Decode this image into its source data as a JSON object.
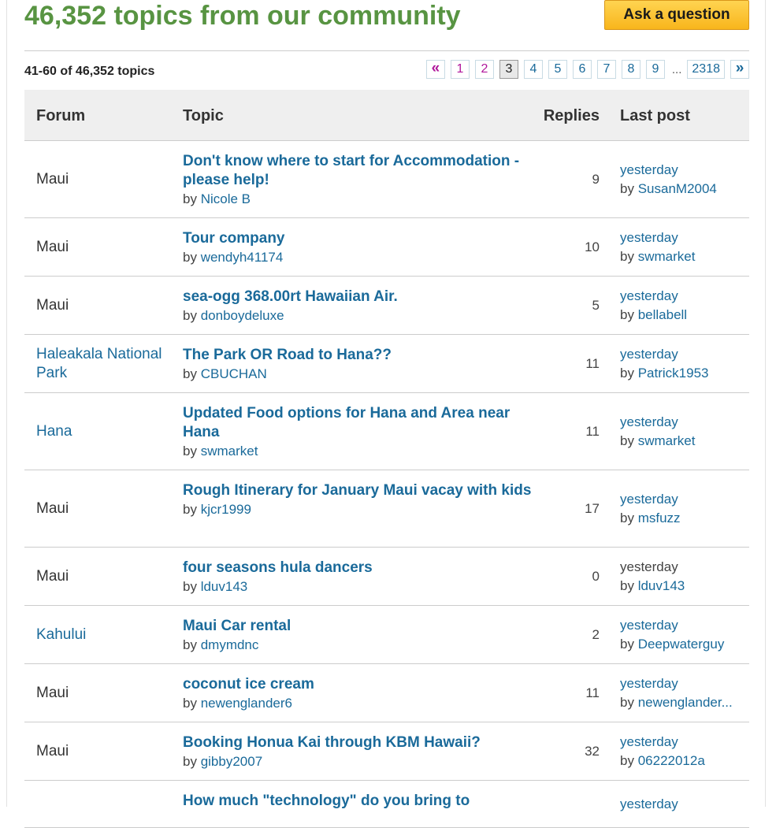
{
  "header": {
    "title": "46,352 topics from our community",
    "ask_button": "Ask a question"
  },
  "pager": {
    "count_text": "41-60 of 46,352 topics",
    "prev": "«",
    "next": "»",
    "pages": [
      "1",
      "2",
      "3",
      "4",
      "5",
      "6",
      "7",
      "8",
      "9"
    ],
    "current_page": "3",
    "ellipsis": "...",
    "last_page": "2318"
  },
  "columns": {
    "forum": "Forum",
    "topic": "Topic",
    "replies": "Replies",
    "last_post": "Last post"
  },
  "by_label": "by",
  "rows": [
    {
      "forum": "Maui",
      "forum_link": false,
      "title": "Don't know where to start for Accommodation - please help!",
      "author": "Nicole B",
      "replies": "9",
      "when": "yesterday",
      "when_link": true,
      "last_by": "SusanM2004"
    },
    {
      "forum": "Maui",
      "forum_link": false,
      "title": "Tour company",
      "author": "wendyh41174",
      "replies": "10",
      "when": "yesterday",
      "when_link": true,
      "last_by": "swmarket"
    },
    {
      "forum": "Maui",
      "forum_link": false,
      "title": "sea-ogg 368.00rt Hawaiian Air.",
      "author": "donboydeluxe",
      "replies": "5",
      "when": "yesterday",
      "when_link": true,
      "last_by": "bellabell"
    },
    {
      "forum": "Haleakala National Park",
      "forum_link": true,
      "title": "The Park OR Road to Hana??",
      "author": "CBUCHAN",
      "replies": "11",
      "when": "yesterday",
      "when_link": true,
      "last_by": "Patrick1953"
    },
    {
      "forum": "Hana",
      "forum_link": true,
      "title": "Updated Food options for Hana and Area near Hana",
      "author": "swmarket",
      "replies": "11",
      "when": "yesterday",
      "when_link": true,
      "last_by": "swmarket"
    },
    {
      "forum": "Maui",
      "forum_link": false,
      "title": "Rough Itinerary for January Maui vacay with kids",
      "author": "kjcr1999",
      "replies": "17",
      "when": "yesterday",
      "when_link": true,
      "last_by": "msfuzz"
    },
    {
      "forum": "Maui",
      "forum_link": false,
      "title": "four seasons hula dancers",
      "author": "lduv143",
      "replies": "0",
      "when": "yesterday",
      "when_link": false,
      "last_by": "lduv143"
    },
    {
      "forum": "Kahului",
      "forum_link": true,
      "title": "Maui Car rental",
      "author": "dmymdnc",
      "replies": "2",
      "when": "yesterday",
      "when_link": true,
      "last_by": "Deepwaterguy"
    },
    {
      "forum": "Maui",
      "forum_link": false,
      "title": "coconut ice cream",
      "author": "newenglander6",
      "replies": "11",
      "when": "yesterday",
      "when_link": true,
      "last_by": "newenglander..."
    },
    {
      "forum": "Maui",
      "forum_link": false,
      "title": "Booking Honua Kai through KBM Hawaii?",
      "author": "gibby2007",
      "replies": "32",
      "when": "yesterday",
      "when_link": true,
      "last_by": "06222012a"
    },
    {
      "forum": "",
      "forum_link": false,
      "title": "How much \"technology\" do you bring to",
      "author": "",
      "replies": "",
      "when": "yesterday",
      "when_link": true,
      "last_by": ""
    }
  ]
}
